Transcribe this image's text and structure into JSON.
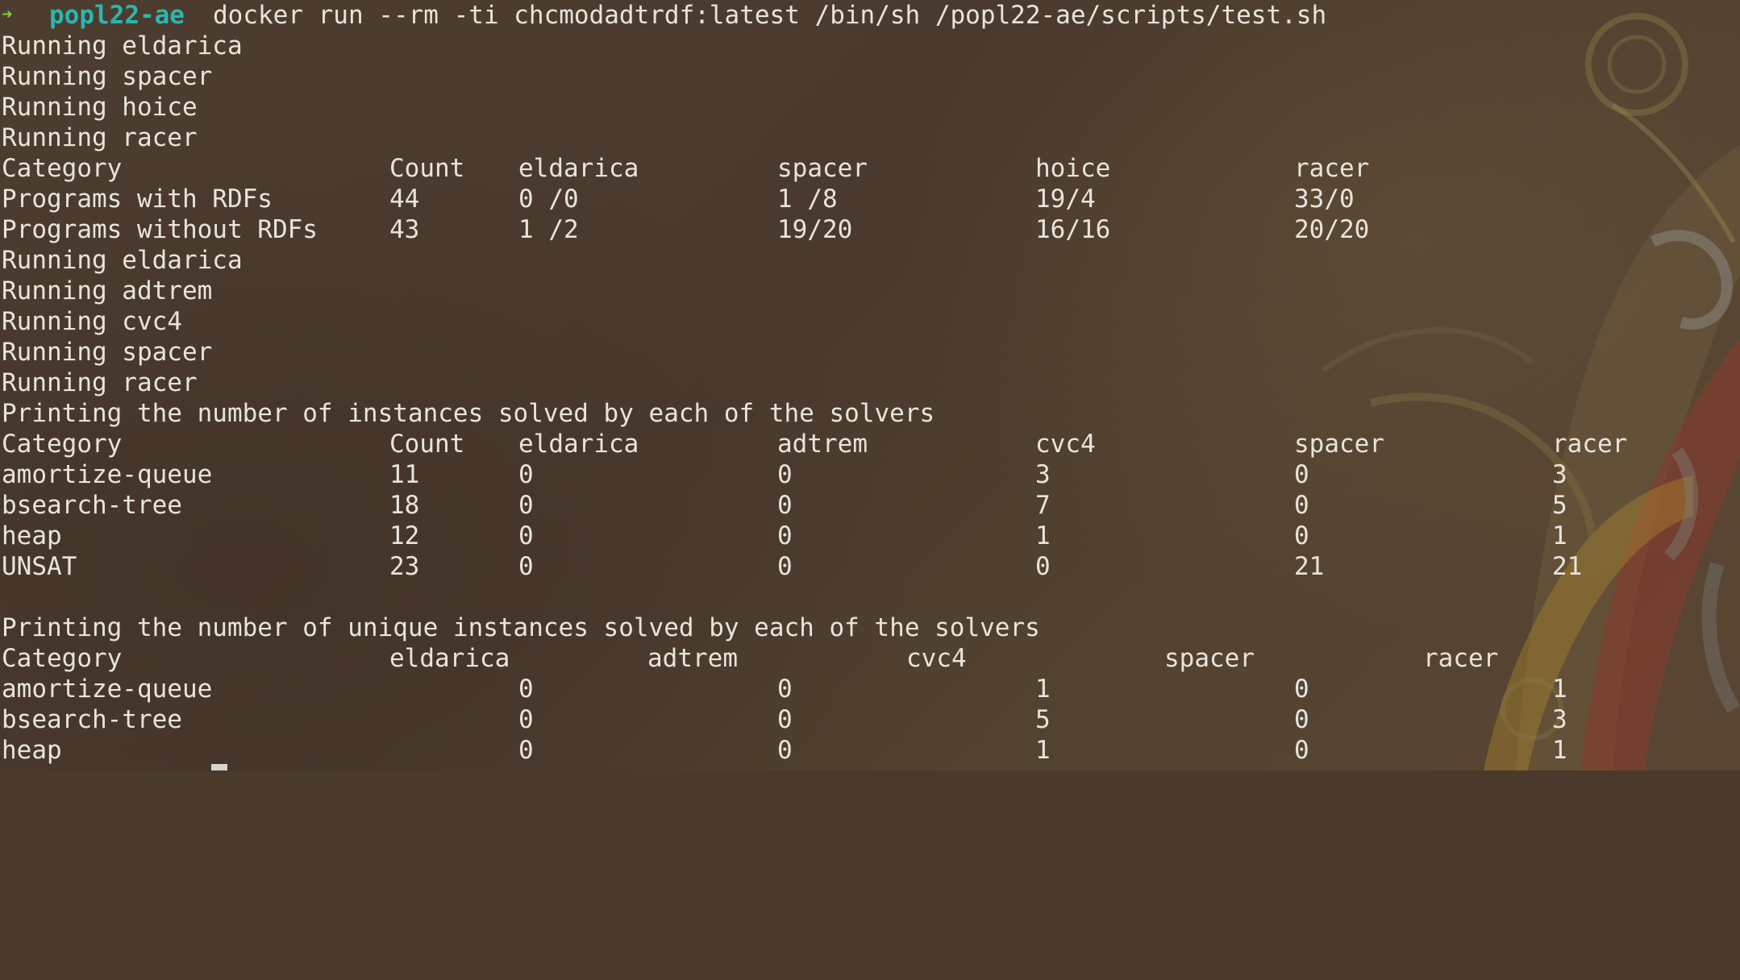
{
  "theme": {
    "background": "#4a3a2c",
    "foreground": "#e8e4dc",
    "prompt_arrow_color": "#7fcf3a",
    "prompt_dir_color": "#2ab7b0"
  },
  "prompt": {
    "arrow": "➜",
    "directory": "popl22-ae",
    "command": "docker run --rm -ti chcmodadtrdf:latest /bin/sh /popl22-ae/scripts/test.sh"
  },
  "run1": [
    "Running eldarica",
    "Running spacer",
    "Running hoice",
    "Running racer"
  ],
  "table1": {
    "header": [
      "Category",
      "Count",
      "eldarica",
      "spacer",
      "hoice",
      "racer"
    ],
    "rows": [
      [
        "Programs with RDFs",
        "44",
        "0 /0",
        "1 /8",
        "19/4",
        "33/0"
      ],
      [
        "Programs without RDFs",
        "43",
        "1 /2",
        "19/20",
        "16/16",
        "20/20"
      ]
    ]
  },
  "run2": [
    "Running eldarica",
    "Running adtrem",
    "Running cvc4",
    "Running spacer",
    "Running racer"
  ],
  "table2": {
    "title": "Printing the number of instances solved by each of the solvers",
    "header": [
      "Category",
      "Count",
      "eldarica",
      "adtrem",
      "cvc4",
      "spacer",
      "racer"
    ],
    "rows": [
      [
        "amortize-queue",
        "11",
        "0",
        "0",
        "3",
        "0",
        "3"
      ],
      [
        "bsearch-tree",
        "18",
        "0",
        "0",
        "7",
        "0",
        "5"
      ],
      [
        "heap",
        "12",
        "0",
        "0",
        "1",
        "0",
        "1"
      ],
      [
        "UNSAT",
        "23",
        "0",
        "0",
        "0",
        "21",
        "21"
      ]
    ]
  },
  "table3": {
    "title": "Printing the number of unique instances solved by each of the solvers",
    "header": [
      "Category",
      "eldarica",
      "adtrem",
      "cvc4",
      "spacer",
      "racer"
    ],
    "rows": [
      [
        "amortize-queue",
        "0",
        "0",
        "1",
        "0",
        "1"
      ],
      [
        "bsearch-tree",
        "0",
        "0",
        "5",
        "0",
        "3"
      ],
      [
        "heap",
        "0",
        "0",
        "1",
        "0",
        "1"
      ]
    ]
  }
}
